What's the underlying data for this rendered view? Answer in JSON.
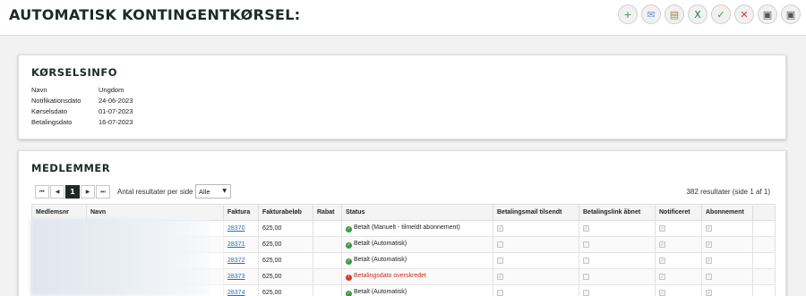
{
  "page": {
    "title": "AUTOMATISK KONTINGENTKØRSEL:"
  },
  "toolbar": {
    "actions": [
      {
        "name": "add-icon",
        "glyph": "+",
        "color": "#3b9a3f"
      },
      {
        "name": "mail-icon",
        "glyph": "✉",
        "color": "#6a8fc4"
      },
      {
        "name": "document-icon",
        "glyph": "▤",
        "color": "#9a8a4a"
      },
      {
        "name": "excel-icon",
        "glyph": "X",
        "color": "#1f7a3a"
      },
      {
        "name": "check-icon",
        "glyph": "✓",
        "color": "#3b9a3f"
      },
      {
        "name": "close-icon",
        "glyph": "✕",
        "color": "#d33b2c"
      },
      {
        "name": "print-icon",
        "glyph": "▣",
        "color": "#555555"
      },
      {
        "name": "print-alt-icon",
        "glyph": "▣",
        "color": "#555555"
      }
    ]
  },
  "info": {
    "title": "KØRSELSINFO",
    "rows": [
      {
        "label": "Navn",
        "value": "Ungdom"
      },
      {
        "label": "Notifikationsdato",
        "value": "24-06-2023"
      },
      {
        "label": "Kørselsdato",
        "value": "01-07-2023"
      },
      {
        "label": "Betalingsdato",
        "value": "16-07-2023"
      }
    ]
  },
  "members": {
    "title": "MEDLEMMER",
    "pager": {
      "first": "⏮",
      "prev": "◀",
      "current": "1",
      "next": "▶",
      "last": "⏭"
    },
    "per_page_label": "Antal resultater per side",
    "per_page_value": "Alle",
    "result_count": "382 resultater (side 1 af 1)",
    "columns": [
      "Medlemsnr",
      "Navn",
      "Faktura",
      "Fakturabeløb",
      "Rabat",
      "Status",
      "Betalingsmail tilsendt",
      "Betalingslink åbnet",
      "Notificeret",
      "Abonnement",
      ""
    ],
    "rows": [
      {
        "faktura": "28370",
        "belob": "625,00",
        "rabat": "",
        "status": "Betalt (Manuelt - tilmeldt abonnement)",
        "status_ok": true,
        "mail": true,
        "link": true,
        "notif": true,
        "abon": true
      },
      {
        "faktura": "28371",
        "belob": "625,00",
        "rabat": "",
        "status": "Betalt (Automatisk)",
        "status_ok": true,
        "mail": false,
        "link": false,
        "notif": true,
        "abon": true
      },
      {
        "faktura": "28372",
        "belob": "625,00",
        "rabat": "",
        "status": "Betalt (Automatisk)",
        "status_ok": true,
        "mail": false,
        "link": false,
        "notif": true,
        "abon": true
      },
      {
        "faktura": "28373",
        "belob": "625,00",
        "rabat": "",
        "status": "Betalingsdato overskredet",
        "status_ok": false,
        "mail": true,
        "link": false,
        "notif": true,
        "abon": false
      },
      {
        "faktura": "28374",
        "belob": "625,00",
        "rabat": "",
        "status": "Betalt (Automatisk)",
        "status_ok": true,
        "mail": false,
        "link": false,
        "notif": true,
        "abon": true
      }
    ]
  }
}
